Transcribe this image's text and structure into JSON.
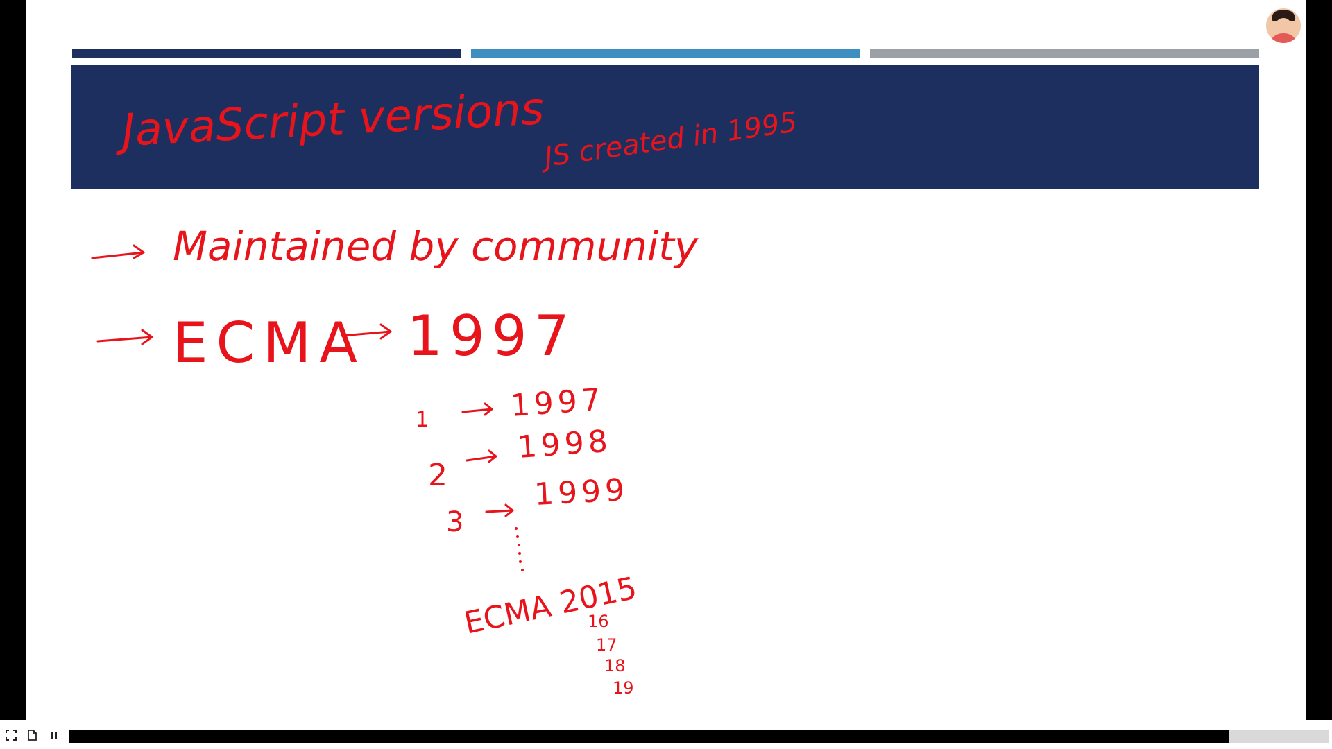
{
  "slide": {
    "title": "JavaScript versions",
    "subtitle_note": "JS created in 1995",
    "bullets": [
      {
        "text": "Maintained by community"
      },
      {
        "text": "ECMA",
        "year": "1997"
      }
    ],
    "versions": [
      {
        "num": "1",
        "year": "1997"
      },
      {
        "num": "2",
        "year": "1998"
      },
      {
        "num": "3",
        "year": "1999"
      }
    ],
    "ecma_2015": "ECMA 2015",
    "later_versions": [
      "16",
      "17",
      "18",
      "19"
    ]
  },
  "player": {
    "progress_fraction": 0.92
  },
  "colors": {
    "ink": "#e8141c",
    "title_bar": "#1c2f5f",
    "accent_blue": "#3e8fbf",
    "accent_gray": "#9aa0a6"
  }
}
